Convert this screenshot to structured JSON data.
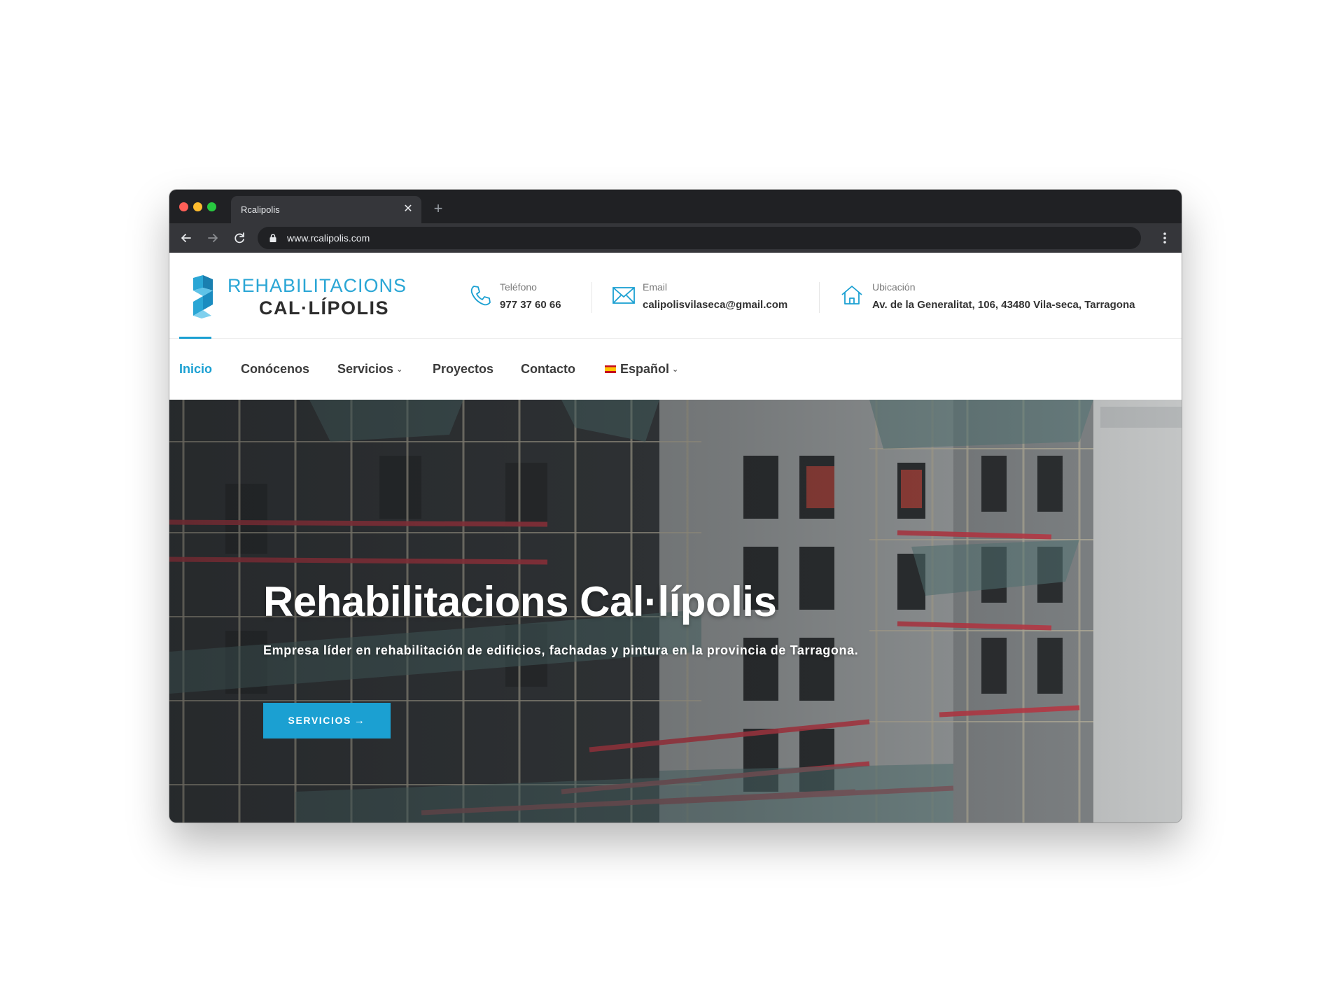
{
  "browser": {
    "tab_title": "Rcalipolis",
    "tab_close": "✕",
    "new_tab": "+",
    "url": "www.rcalipolis.com"
  },
  "logo": {
    "line1": "REHABILITACIONS",
    "line2": "CAL·LÍPOLIS"
  },
  "contacts": {
    "phone": {
      "label": "Teléfono",
      "value": "977 37 60 66"
    },
    "email": {
      "label": "Email",
      "value": "calipolisvilaseca@gmail.com"
    },
    "location": {
      "label": "Ubicación",
      "value": "Av. de la Generalitat, 106, 43480 Vila-seca, Tarragona"
    }
  },
  "nav": {
    "home": "Inicio",
    "about": "Conócenos",
    "services": "Servicios",
    "projects": "Proyectos",
    "contact": "Contacto",
    "language": "Español"
  },
  "hero": {
    "title": "Rehabilitacions Cal·lípolis",
    "subtitle": "Empresa líder en rehabilitación de edificios, fachadas y pintura en la provincia de Tarragona.",
    "button_label": "SERVICIOS",
    "button_arrow": "→"
  },
  "colors": {
    "accent": "#1ba0d2",
    "logo_blue": "#2aa6d5",
    "text_dark": "#3a3a3a",
    "chrome_dark": "#202124",
    "chrome_tab": "#35363a",
    "traffic_red": "#ff5f57",
    "traffic_yellow": "#febc2e",
    "traffic_green": "#28c840"
  }
}
